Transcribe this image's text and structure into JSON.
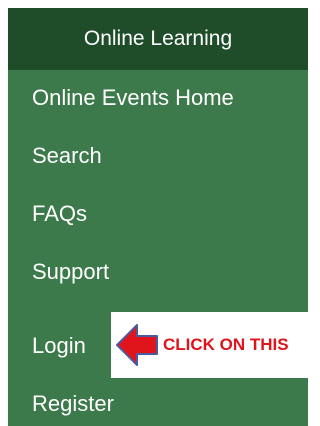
{
  "menu": {
    "title": "Online Learning",
    "items": [
      {
        "label": "Online Events Home"
      },
      {
        "label": "Search"
      },
      {
        "label": "FAQs"
      },
      {
        "label": "Support"
      },
      {
        "label": "Login"
      },
      {
        "label": "Register"
      }
    ]
  },
  "annotation": {
    "text": "CLICK ON THIS",
    "icon": "left-arrow-icon",
    "color": "#e0141b"
  },
  "colors": {
    "header_bg": "#1f4d2a",
    "menu_bg": "#3c7a4b",
    "text": "#ffffff"
  }
}
